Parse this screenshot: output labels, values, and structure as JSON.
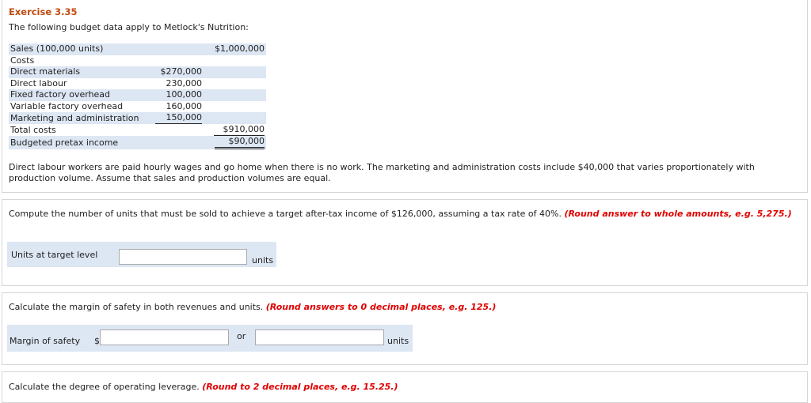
{
  "exercise_title": "Exercise 3.35",
  "intro": "The following budget data apply to Metlock's Nutrition:",
  "budget_rows": [
    {
      "label": "Sales (100,000 units)",
      "mid": "",
      "right": "$1,000,000"
    },
    {
      "label": "Costs",
      "mid": "",
      "right": ""
    },
    {
      "label": "Direct materials",
      "mid": "$270,000",
      "right": ""
    },
    {
      "label": "Direct labour",
      "mid": "230,000",
      "right": ""
    },
    {
      "label": "Fixed factory overhead",
      "mid": "100,000",
      "right": ""
    },
    {
      "label": "Variable factory overhead",
      "mid": "160,000",
      "right": ""
    },
    {
      "label": "Marketing and administration",
      "mid": "150,000",
      "right": ""
    },
    {
      "label": "Total costs",
      "mid": "",
      "right": "$910,000"
    },
    {
      "label": "Budgeted pretax income",
      "mid": "",
      "right": "$90,000"
    }
  ],
  "paragraph": "Direct labour workers are paid hourly wages and go home when there is no work. The marketing and administration costs include $40,000 that varies proportionately with production volume. Assume that sales and production volumes are equal.",
  "q1": {
    "text": "Compute the number of units that must be sold to achieve a target after-tax income of $126,000, assuming a tax rate of 40%.",
    "hint": "(Round answer to whole amounts, e.g. 5,275.)",
    "field_label": "Units at target level",
    "unit": "units",
    "value": ""
  },
  "q2": {
    "text": "Calculate the margin of safety in both revenues and units.",
    "hint": "(Round answers to 0 decimal places, e.g. 125.)",
    "field_label": "Margin of safety",
    "currency": "$",
    "or": "or",
    "unit": "units",
    "value_dollars": "",
    "value_units": ""
  },
  "q3": {
    "text": "Calculate the degree of operating leverage.",
    "hint": "(Round to 2 decimal places, e.g. 15.25.)"
  },
  "colors": {
    "accent": "#c14a0f",
    "hint": "#e00000",
    "shade": "#dde6f3"
  }
}
